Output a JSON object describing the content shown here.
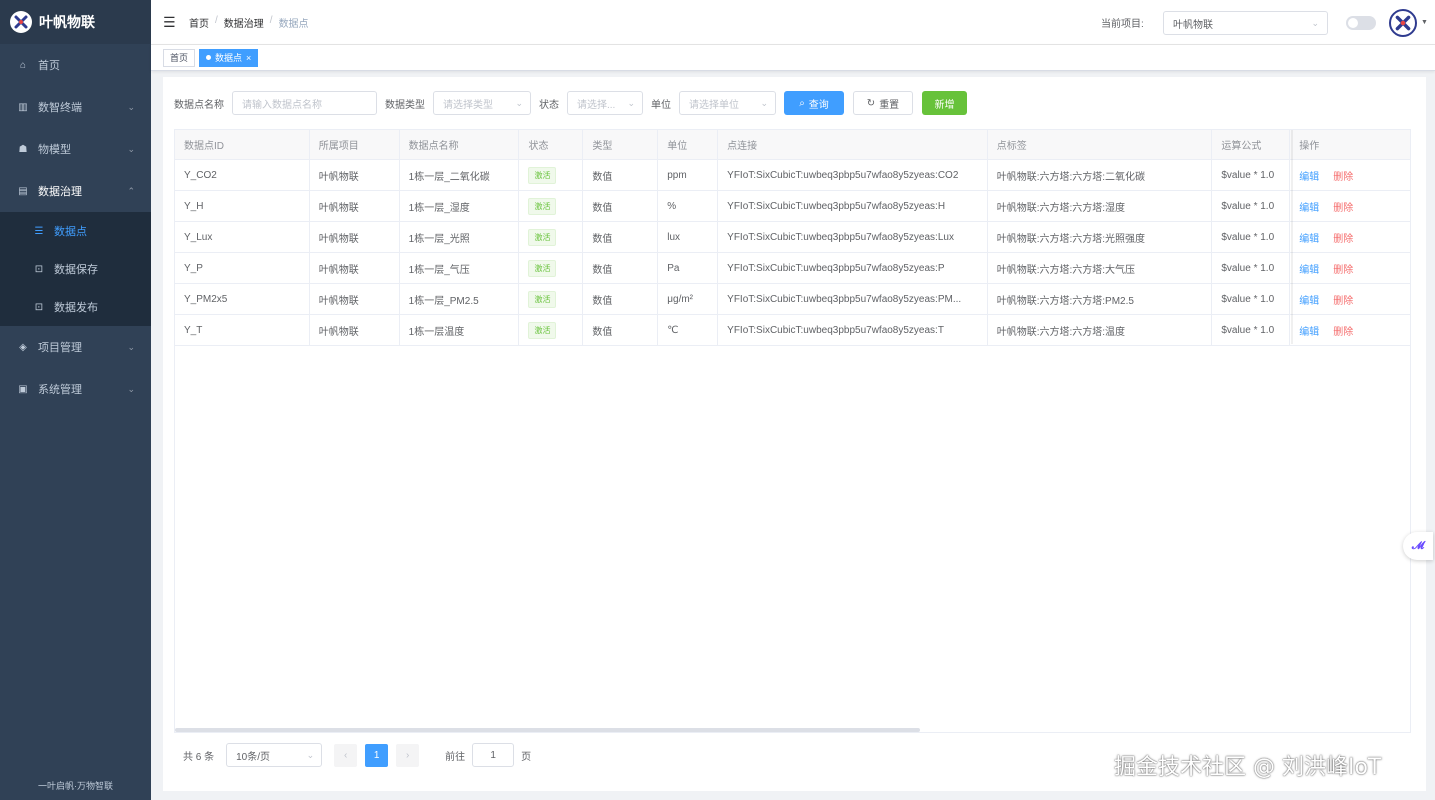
{
  "app": {
    "name": "叶帆物联",
    "footer": "一叶启帆·万物智联"
  },
  "sidebar": {
    "items": [
      {
        "label": "首页",
        "icon": "home-icon"
      },
      {
        "label": "数智终端",
        "icon": "terminal-icon"
      },
      {
        "label": "物模型",
        "icon": "model-icon"
      },
      {
        "label": "数据治理",
        "icon": "document-icon"
      },
      {
        "label": "项目管理",
        "icon": "project-icon"
      },
      {
        "label": "系统管理",
        "icon": "system-icon"
      }
    ],
    "sub_items": [
      {
        "label": "数据点",
        "icon": "list-icon"
      },
      {
        "label": "数据保存",
        "icon": "save-icon"
      },
      {
        "label": "数据发布",
        "icon": "publish-icon"
      }
    ]
  },
  "header": {
    "breadcrumb": [
      "首页",
      "数据治理",
      "数据点"
    ],
    "project_label": "当前项目:",
    "project_value": "叶帆物联"
  },
  "tags": {
    "home": "首页",
    "active": "数据点"
  },
  "filter": {
    "name_label": "数据点名称",
    "name_placeholder": "请输入数据点名称",
    "type_label": "数据类型",
    "type_placeholder": "请选择类型",
    "status_label": "状态",
    "status_placeholder": "请选择...",
    "unit_label": "单位",
    "unit_placeholder": "请选择单位",
    "search_btn": "查询",
    "reset_btn": "重置",
    "add_btn": "新增"
  },
  "table": {
    "columns": [
      "数据点ID",
      "所属项目",
      "数据点名称",
      "状态",
      "类型",
      "单位",
      "点连接",
      "点标签",
      "运算公式",
      "操作"
    ],
    "edit_label": "编辑",
    "delete_label": "删除",
    "rows": [
      [
        "Y_CO2",
        "叶帆物联",
        "1栋一层_二氧化碳",
        "激活",
        "数值",
        "ppm",
        "YFIoT:SixCubicT:uwbeq3pbp5u7wfao8y5zyeas:CO2",
        "叶帆物联:六方塔:六方塔:二氧化碳",
        "$value * 1.0"
      ],
      [
        "Y_H",
        "叶帆物联",
        "1栋一层_湿度",
        "激活",
        "数值",
        "%",
        "YFIoT:SixCubicT:uwbeq3pbp5u7wfao8y5zyeas:H",
        "叶帆物联:六方塔:六方塔:湿度",
        "$value * 1.0"
      ],
      [
        "Y_Lux",
        "叶帆物联",
        "1栋一层_光照",
        "激活",
        "数值",
        "lux",
        "YFIoT:SixCubicT:uwbeq3pbp5u7wfao8y5zyeas:Lux",
        "叶帆物联:六方塔:六方塔:光照强度",
        "$value * 1.0"
      ],
      [
        "Y_P",
        "叶帆物联",
        "1栋一层_气压",
        "激活",
        "数值",
        "Pa",
        "YFIoT:SixCubicT:uwbeq3pbp5u7wfao8y5zyeas:P",
        "叶帆物联:六方塔:六方塔:大气压",
        "$value * 1.0"
      ],
      [
        "Y_PM2x5",
        "叶帆物联",
        "1栋一层_PM2.5",
        "激活",
        "数值",
        "μg/m²",
        "YFIoT:SixCubicT:uwbeq3pbp5u7wfao8y5zyeas:PM...",
        "叶帆物联:六方塔:六方塔:PM2.5",
        "$value * 1.0"
      ],
      [
        "Y_T",
        "叶帆物联",
        "1栋一层温度",
        "激活",
        "数值",
        "℃",
        "YFIoT:SixCubicT:uwbeq3pbp5u7wfao8y5zyeas:T",
        "叶帆物联:六方塔:六方塔:温度",
        "$value * 1.0"
      ]
    ]
  },
  "pager": {
    "total": "共 6 条",
    "page_size": "10条/页",
    "prev": "‹",
    "current": "1",
    "next": "›",
    "goto_label": "前往",
    "goto_value": "1",
    "page_suffix": "页"
  },
  "watermark": "掘金技术社区 @ 刘洪峰IoT",
  "colors": {
    "primary": "#409eff",
    "success": "#67c23a",
    "danger": "#f56c6c",
    "sidebar": "#304156"
  }
}
